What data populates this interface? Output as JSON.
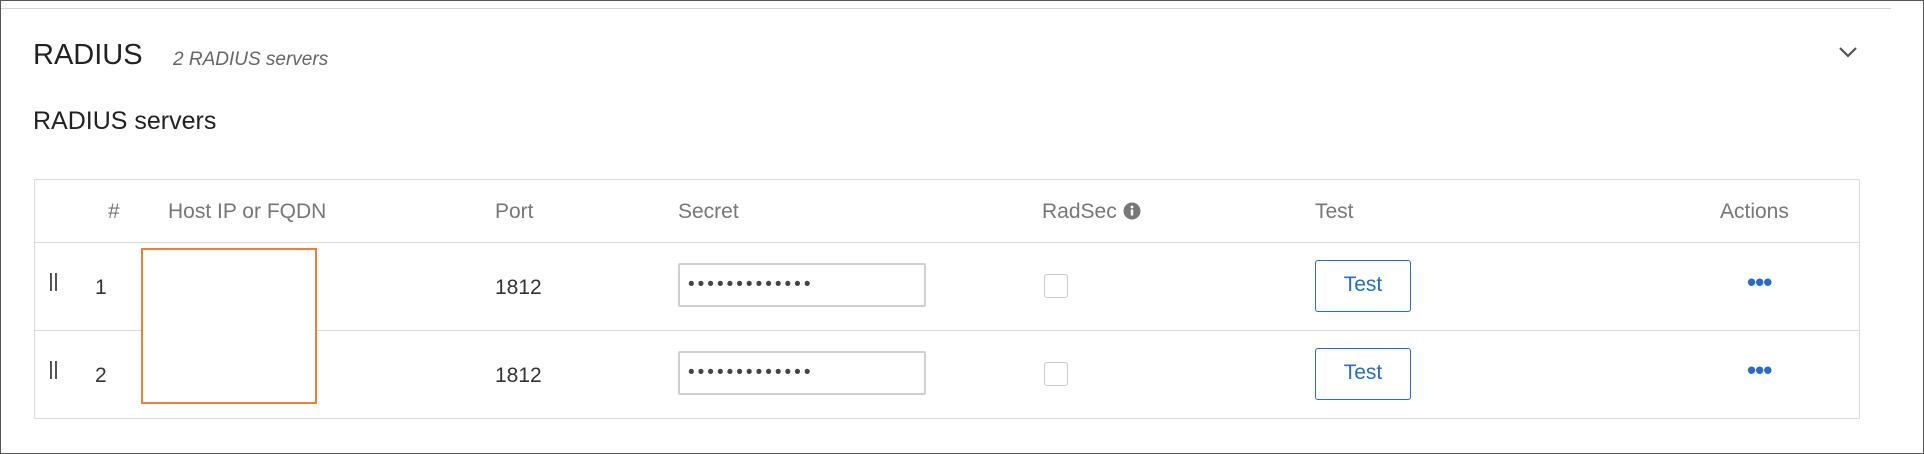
{
  "section": {
    "title": "RADIUS",
    "subtitle": "2 RADIUS servers",
    "collapse_icon": "chevron-down-icon"
  },
  "servers_heading": "RADIUS servers",
  "table": {
    "headers": {
      "number": "#",
      "host": "Host IP or FQDN",
      "port": "Port",
      "secret": "Secret",
      "radsec": "RadSec",
      "test": "Test",
      "actions": "Actions"
    },
    "rows": [
      {
        "number": "1",
        "host": "",
        "port": "1812",
        "secret": "•••••••••••••",
        "radsec": false,
        "test_label": "Test",
        "actions_icon": "more-horizontal-icon"
      },
      {
        "number": "2",
        "host": "",
        "port": "1812",
        "secret": "•••••••••••••",
        "radsec": false,
        "test_label": "Test",
        "actions_icon": "more-horizontal-icon"
      }
    ]
  },
  "colors": {
    "accent": "#2a6cc4",
    "highlight": "#ee7f3b",
    "border": "#dadada",
    "header_text": "#777777"
  }
}
